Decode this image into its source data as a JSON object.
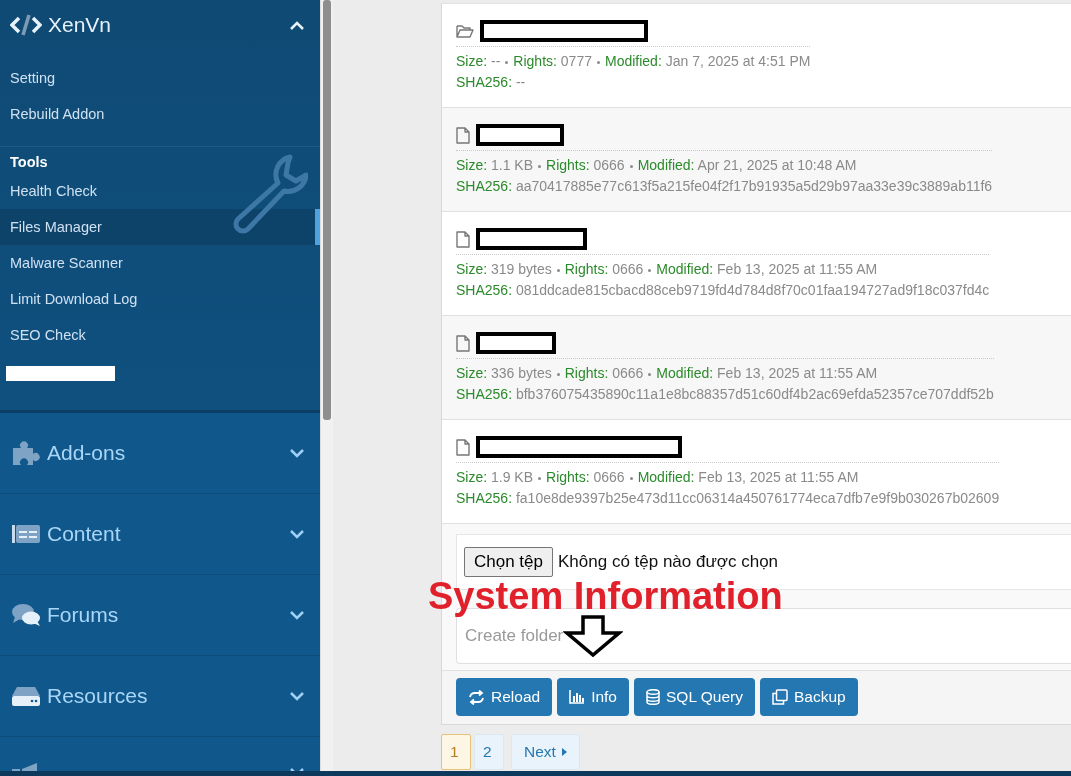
{
  "sidebar": {
    "brand": {
      "title": "XenVn",
      "expanded": true
    },
    "links": [
      {
        "label": "Setting",
        "selected": false
      },
      {
        "label": "Rebuild Addon",
        "selected": false
      }
    ],
    "tools": {
      "heading": "Tools",
      "items": [
        {
          "label": "Health Check",
          "selected": false
        },
        {
          "label": "Files Manager",
          "selected": true
        },
        {
          "label": "Malware Scanner",
          "selected": false
        },
        {
          "label": "Limit Download Log",
          "selected": false
        },
        {
          "label": "SEO Check",
          "selected": false
        },
        {
          "kind": "redacted",
          "selected": false
        }
      ]
    },
    "sections": [
      {
        "kind": "addons",
        "label": "Add-ons",
        "expanded": false
      },
      {
        "kind": "content",
        "label": "Content",
        "expanded": false
      },
      {
        "kind": "forums",
        "label": "Forums",
        "expanded": false
      },
      {
        "kind": "resources",
        "label": "Resources",
        "expanded": false
      },
      {
        "kind": "communication",
        "expanded": false
      }
    ]
  },
  "files": [
    {
      "kind": "folder",
      "fields": [
        {
          "label": "Size:",
          "value": "--"
        },
        {
          "label": "Rights:",
          "value": "0777"
        },
        {
          "label": "Modified:",
          "value": "Jan 7, 2025 at 4:51 PM"
        }
      ],
      "hash": {
        "label": "SHA256:",
        "value": "--"
      }
    },
    {
      "kind": "file",
      "fields": [
        {
          "label": "Size:",
          "value": "1.1 KB"
        },
        {
          "label": "Rights:",
          "value": "0666"
        },
        {
          "label": "Modified:",
          "value": "Apr 21, 2025 at 10:48 AM"
        }
      ],
      "hash": {
        "label": "SHA256:",
        "value": "aa70417885e77c613f5a215fe04f2f17b91935a5d29b97aa33e39c3889ab11f6"
      }
    },
    {
      "kind": "file",
      "fields": [
        {
          "label": "Size:",
          "value": "319 bytes"
        },
        {
          "label": "Rights:",
          "value": "0666"
        },
        {
          "label": "Modified:",
          "value": "Feb 13, 2025 at 11:55 AM"
        }
      ],
      "hash": {
        "label": "SHA256:",
        "value": "081ddcade815cbacd88ceb9719fd4d784d8f70c01faa194727ad9f18c037fd4c"
      }
    },
    {
      "kind": "file",
      "fields": [
        {
          "label": "Size:",
          "value": "336 bytes"
        },
        {
          "label": "Rights:",
          "value": "0666"
        },
        {
          "label": "Modified:",
          "value": "Feb 13, 2025 at 11:55 AM"
        }
      ],
      "hash": {
        "label": "SHA256:",
        "value": "bfb376075435890c11a1e8bc88357d51c60df4b2ac69efda52357ce707ddf52b"
      }
    },
    {
      "kind": "file",
      "fields": [
        {
          "label": "Size:",
          "value": "1.9 KB"
        },
        {
          "label": "Rights:",
          "value": "0666"
        },
        {
          "label": "Modified:",
          "value": "Feb 13, 2025 at 11:55 AM"
        }
      ],
      "hash": {
        "label": "SHA256:",
        "value": "fa10e8de9397b25e473d11cc06314a450761774eca7dfb7e9f9b030267b02609"
      }
    }
  ],
  "upload": {
    "button": "Chọn tệp",
    "status": "Không có tệp nào được chọn"
  },
  "create_folder": {
    "placeholder": "Create folder"
  },
  "actions": [
    {
      "kind": "reload",
      "label": "Reload"
    },
    {
      "kind": "info",
      "label": "Info"
    },
    {
      "kind": "sql",
      "label": "SQL Query"
    },
    {
      "kind": "backup",
      "label": "Backup"
    }
  ],
  "pagination": {
    "pages": [
      {
        "label": "1",
        "selected": true
      },
      {
        "label": "2",
        "selected": false
      }
    ],
    "next": "Next"
  },
  "annotation": {
    "text": "System Information"
  }
}
